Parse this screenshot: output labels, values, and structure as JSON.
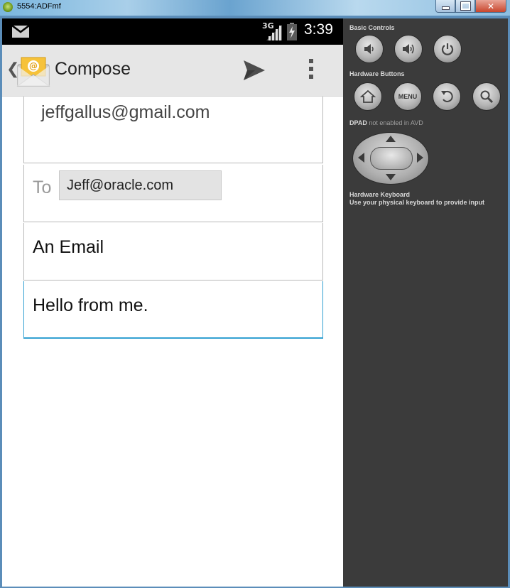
{
  "window": {
    "title": "5554:ADFmf",
    "buttons": [
      "minimize-icon",
      "maximize-icon",
      "close-icon"
    ]
  },
  "status_bar": {
    "notification_icon": "gmail-icon",
    "network": "3G",
    "signal_icon": "signal-icon",
    "battery_icon": "battery-icon",
    "time": "3:39"
  },
  "action_bar": {
    "back_glyph": "❮",
    "app_icon": "email-app-icon",
    "title": "Compose",
    "send_icon": "send-icon",
    "overflow_icon": "overflow-menu-icon"
  },
  "compose": {
    "from": "jeffgallus@gmail.com",
    "to_label": "To",
    "to_recipient": "Jeff@oracle.com",
    "subject": "An Email",
    "body": "Hello from me."
  },
  "controls": {
    "basic_controls_title": "Basic Controls",
    "hardware_buttons_title": "Hardware Buttons",
    "menu_label": "MENU",
    "dpad_title": "DPAD",
    "dpad_note": "not enabled in AVD",
    "keyboard_title": "Hardware Keyboard",
    "keyboard_note": "Use your physical keyboard to provide input"
  },
  "colors": {
    "focus_accent": "#33a1d2",
    "action_bar_bg": "#e6e6e6",
    "panel_bg": "#3b3b3b"
  }
}
